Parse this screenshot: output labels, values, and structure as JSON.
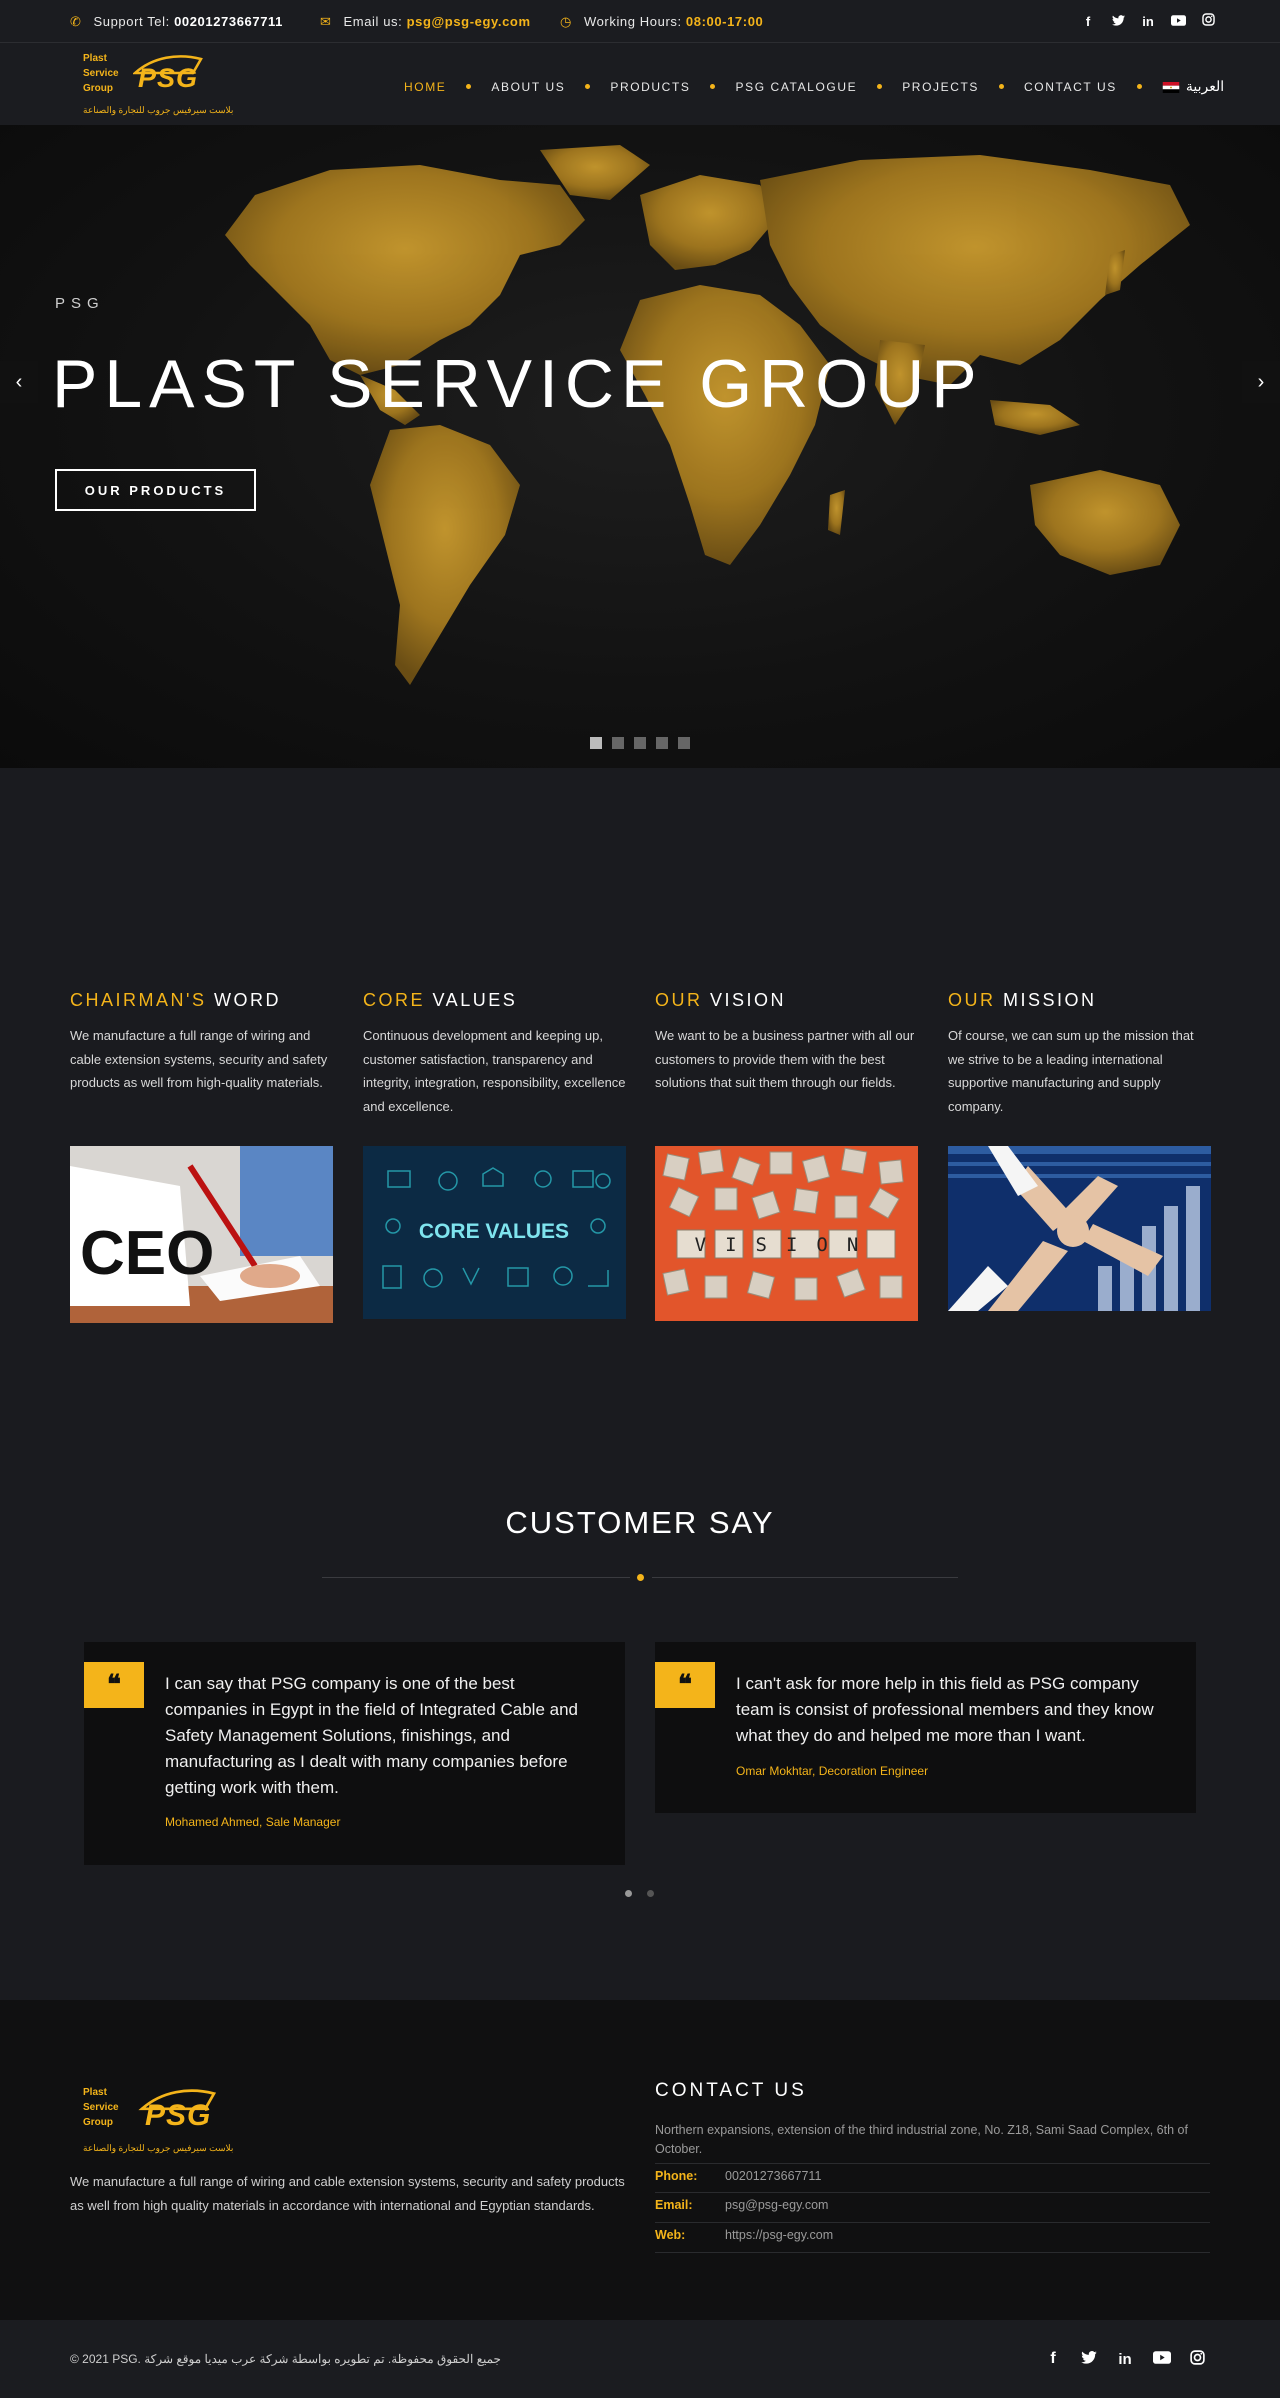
{
  "topbar": {
    "support_label": "Support Tel:",
    "support_phone": "00201273667711",
    "email_label": "Email us:",
    "email": "psg@psg-egy.com",
    "hours_label": "Working Hours:",
    "hours": "08:00-17:00",
    "social": [
      "facebook-icon",
      "twitter-icon",
      "linkedin-icon",
      "youtube-icon",
      "instagram-icon"
    ]
  },
  "logo": {
    "line1": "Plast",
    "line2": "Service",
    "line3": "Group",
    "mark": "PSG",
    "arabic": "بلاست سيرفيس جروب للتجارة والصناعة"
  },
  "nav": {
    "items": [
      "HOME",
      "ABOUT US",
      "PRODUCTS",
      "PSG CATALOGUE",
      "PROJECTS",
      "CONTACT US"
    ],
    "active": "HOME",
    "language": "العربية"
  },
  "hero": {
    "eyebrow": "PSG",
    "title": "PLAST SERVICE GROUP",
    "button": "OUR PRODUCTS",
    "slide_count": 5,
    "active_slide": 1
  },
  "features": [
    {
      "accent": "CHAIRMAN'S",
      "rest": " WORD",
      "text": "We manufacture a full range of wiring and cable extension systems, security and safety products as well from high-quality materials.",
      "image_label": "CEO"
    },
    {
      "accent": "CORE",
      "rest": " VALUES",
      "text": "Continuous development and keeping up, customer satisfaction, transparency and integrity, integration, responsibility, excellence and excellence.",
      "image_label": "CORE VALUES"
    },
    {
      "accent": "OUR",
      "rest": " VISION",
      "text": "We want to be a business partner with all our customers to provide them with the best solutions that suit them through our fields.",
      "image_label": "VISION"
    },
    {
      "accent": "OUR",
      "rest": " MISSION",
      "text": "Of course, we can sum up the mission that we strive to be a leading international supportive manufacturing and supply company."
    }
  ],
  "testimonials": {
    "title": "CUSTOMER SAY",
    "items": [
      {
        "quote": "I can say that PSG company is one of the best companies in Egypt in the field of Integrated Cable and Safety Management Solutions, finishings, and manufacturing as I dealt with many companies before getting work with them.",
        "author": "Mohamed Ahmed, Sale Manager"
      },
      {
        "quote": "I can't ask for more help in this field as PSG company team is consist of professional members and they know what they do and helped me more than I want.",
        "author": "Omar Mokhtar, Decoration Engineer"
      }
    ],
    "active_page": 1,
    "page_count": 2
  },
  "footer": {
    "description": "We manufacture a full range of wiring and cable extension systems, security and safety products as well from high quality materials in accordance with international and Egyptian standards.",
    "contact_title": "CONTACT US",
    "address": "Northern expansions, extension of the third industrial zone, No. Z18, Sami Saad Complex, 6th of October.",
    "phone_label": "Phone:",
    "phone": "00201273667711",
    "email_label": "Email:",
    "email": "psg@psg-egy.com",
    "web_label": "Web:",
    "web": "https://psg-egy.com",
    "copyright": "© 2021 PSG. جميع الحقوق محفوظة. تم تطويره بواسطة شركة عرب ميديا موقع شركة",
    "accent_color": "#f4b41a"
  }
}
